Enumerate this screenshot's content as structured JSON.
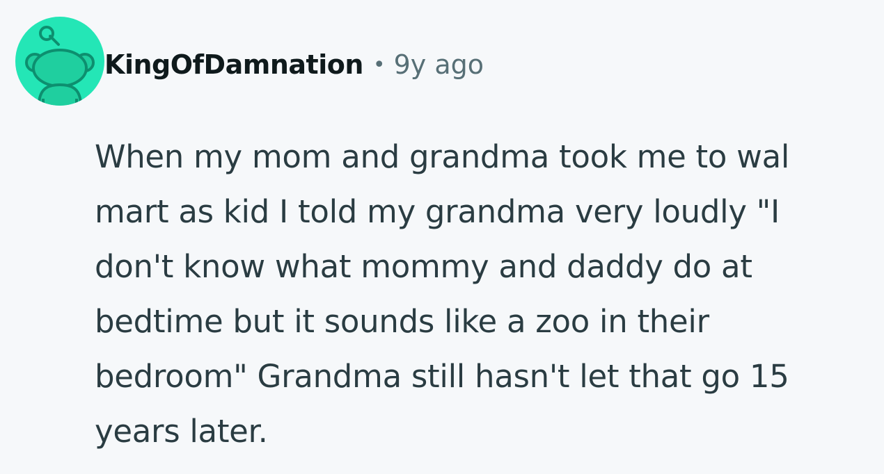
{
  "comment": {
    "author": "KingOfDamnation",
    "separator": "•",
    "timestamp": "9y ago",
    "avatar_icon": "snoo-avatar-icon",
    "avatar_color": "#24e6b6",
    "body_lines": [
      "When my mom and grandma took me to wal",
      "mart as kid I told my grandma very loudly \"I",
      "don't know what mommy and daddy do at",
      "bedtime but it sounds like a zoo in their",
      "bedroom\" Grandma still hasn't let that go 15",
      "years later."
    ]
  }
}
